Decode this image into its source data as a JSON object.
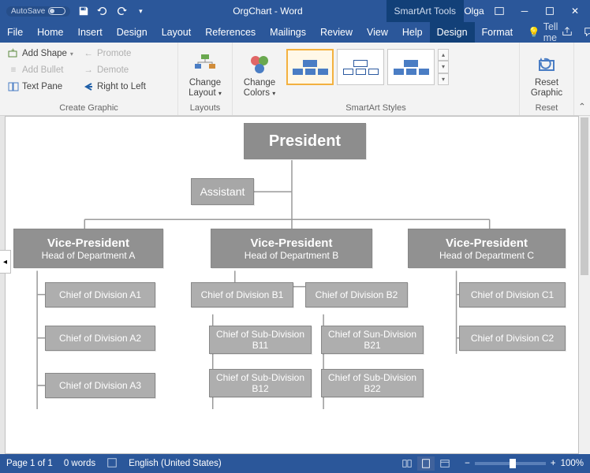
{
  "titlebar": {
    "autosave": "AutoSave",
    "title": "OrgChart - Word",
    "tool_tab": "SmartArt Tools",
    "user": "Olga"
  },
  "menu": {
    "file": "File",
    "home": "Home",
    "insert": "Insert",
    "design1": "Design",
    "layout": "Layout",
    "references": "References",
    "mailings": "Mailings",
    "review": "Review",
    "view": "View",
    "help": "Help",
    "design2": "Design",
    "format": "Format",
    "tellme": "Tell me"
  },
  "ribbon": {
    "create": {
      "add_shape": "Add Shape",
      "add_bullet": "Add Bullet",
      "text_pane": "Text Pane",
      "promote": "Promote",
      "demote": "Demote",
      "rtl": "Right to Left",
      "label": "Create Graphic"
    },
    "layouts": {
      "change_layout": "Change\nLayout",
      "label": "Layouts"
    },
    "colors": {
      "change_colors": "Change\nColors"
    },
    "styles": {
      "label": "SmartArt Styles"
    },
    "reset": {
      "reset_graphic": "Reset\nGraphic",
      "label": "Reset"
    }
  },
  "chart_data": {
    "type": "org-hierarchy",
    "president": "President",
    "assistant": "Assistant",
    "vps": [
      {
        "title": "Vice-President",
        "sub": "Head of Department A",
        "children": [
          "Chief of Division A1",
          "Chief of Division A2",
          "Chief of Division A3"
        ]
      },
      {
        "title": "Vice-President",
        "sub": "Head of Department B",
        "children_lvl1": [
          "Chief of Division B1",
          "Chief of Division B2"
        ],
        "children_lvl2": [
          "Chief of Sub-Division B11",
          "Chief of Sun-Division B21",
          "Chief of Sub-Division B12",
          "Chief of Sub-Division B22"
        ]
      },
      {
        "title": "Vice-President",
        "sub": "Head of Department C",
        "children": [
          "Chief of Division C1",
          "Chief of Division C2"
        ]
      }
    ]
  },
  "status": {
    "page": "Page 1 of 1",
    "words": "0 words",
    "lang": "English (United States)",
    "zoom": "100%"
  }
}
